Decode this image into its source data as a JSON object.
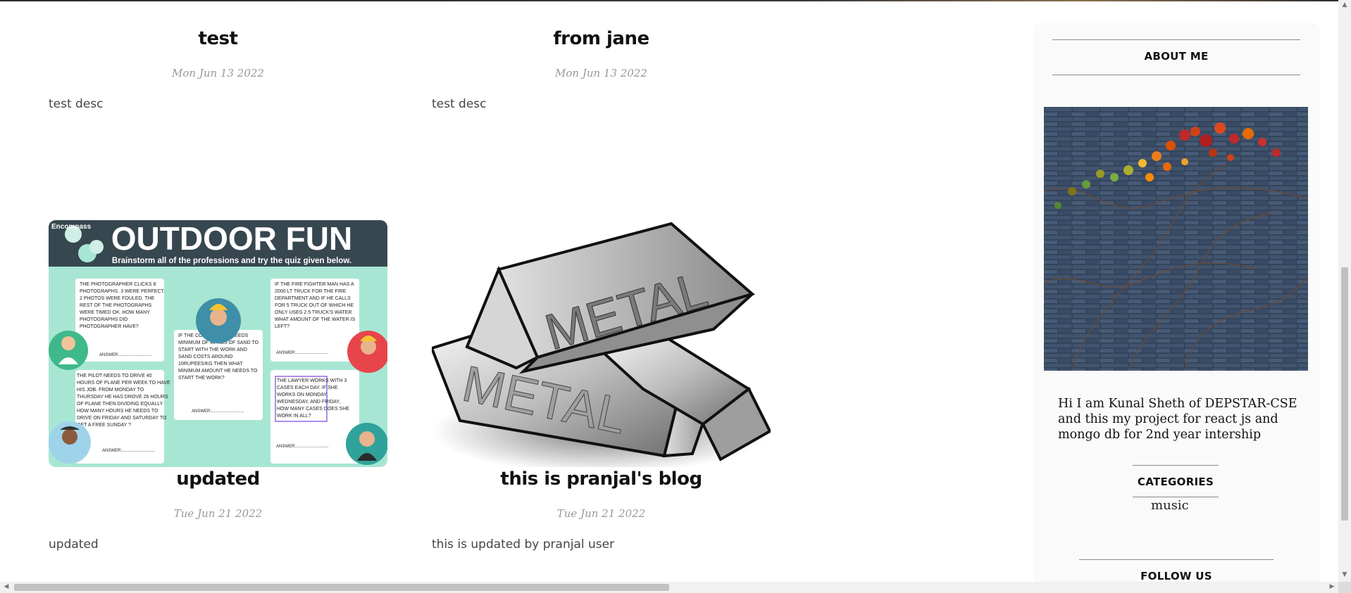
{
  "posts": [
    {
      "title": "test",
      "date": "Mon Jun 13 2022",
      "desc": "test desc"
    },
    {
      "title": "from jane",
      "date": "Mon Jun 13 2022",
      "desc": "test desc"
    },
    {
      "title": "updated",
      "date": "Tue Jun 21 2022",
      "desc": "updated",
      "image": {
        "name": "outdoor-fun-worksheet-image",
        "brand": "Encompass",
        "heading": "OUTDOOR FUN",
        "subheading": "Brainstorm all of the professions and try the quiz given below.",
        "q1": [
          "THE PHOTOGRAPHER CLICKS 8",
          "PHOTOGRAPHS. 3 WERE PERFECT.",
          "2 PHOTOS WERE FOULED. THE",
          "REST OF THE PHOTOGRAPHS",
          "WERE TIMED OK. HOW MANY",
          "PHOTOGRAPHS DID",
          "PHOTOGRAPHER HAVE?"
        ],
        "q2": [
          "IF THE CONTRACTOR NEEDS",
          "MINIMUM OF 40 KGS OF SAND TO",
          "START WITH THE WORK AND",
          "SAND COSTS AROUND",
          "10RUPEES/KG THEN WHAT",
          "MINIMUM AMOUNT HE NEEDS TO",
          "START THE WORK?"
        ],
        "q3": [
          "IF THE FIRE FIGHTER MAN HAS A",
          "2000 LT TRUCK FOR THE FIRE",
          "DEPARTMENT AND IF HE CALLS",
          "FOR 5 TRUCK OUT OF WHICH HE",
          "ONLY USES 2.5 TRUCK'S WATER",
          "WHAT AMOUNT OF THE WATER IS",
          "LEFT?"
        ],
        "q4": [
          "THE PILOT NEEDS TO DRIVE 40",
          "HOURS OF PLANE PER WEEK TO HAVE",
          "HIS JOB. FROM MONDAY TO",
          "THURSDAY HE HAS DROVE 26 HOURS",
          "OF PLANE THEN DIVIDING EQUALLY",
          "HOW MANY HOURS HE NEEDS TO",
          "DRIVE ON FRIDAY AND SATURDAY TO",
          "GET A FREE SUNDAY ?"
        ],
        "q5": [
          "THE LAWYER WORKS WITH 3",
          "CASES EACH DAY. IF SHE",
          "WORKS ON MONDAY,",
          "WEDNESDAY, AND FRIDAY,",
          "HOW MANY CASES DOES SHE",
          "WORK IN ALL?"
        ],
        "answer": "ANSWER:............................"
      }
    },
    {
      "title": "this is pranjal's blog",
      "date": "Tue Jun 21 2022",
      "desc": "this is updated by pranjal user",
      "image": {
        "name": "metal-ingots-image",
        "label_top": "METAL",
        "label_bottom": "METAL"
      }
    }
  ],
  "sidebar": {
    "about_title": "ABOUT ME",
    "about_text": "Hi I am Kunal Sheth of DEPSTAR-CSE and this my project for react js and mongo db for 2nd year intership",
    "categories_title": "CATEGORIES",
    "categories": [
      "music"
    ],
    "follow_title": "FOLLOW US"
  },
  "colors": {
    "worksheet_bg": "#a8e6d4",
    "worksheet_header": "#37474f",
    "sidebar_bg": "#fafafa"
  },
  "icons": {
    "scroll_up": "▲",
    "scroll_down": "▼",
    "scroll_left": "◀",
    "scroll_right": "▶"
  }
}
